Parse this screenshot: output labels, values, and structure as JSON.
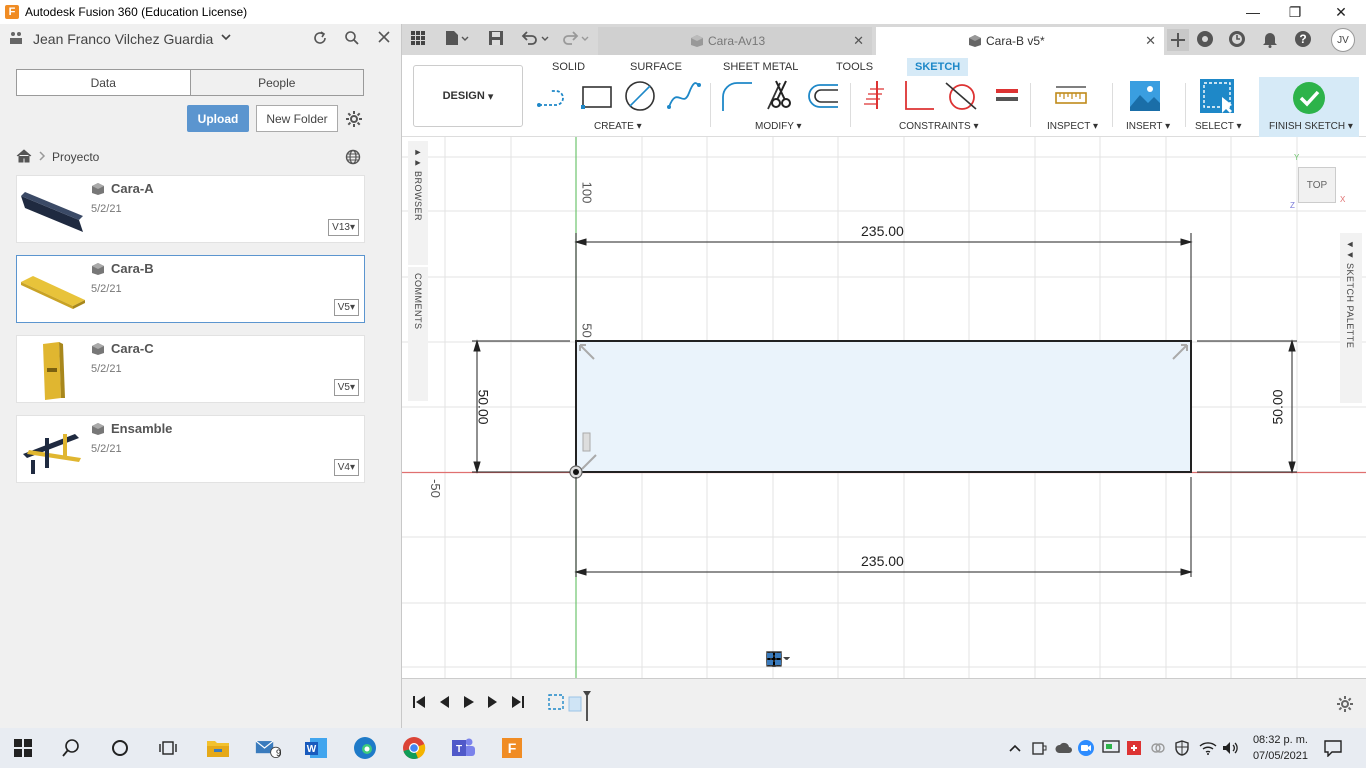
{
  "window": {
    "app_icon_letter": "F",
    "title": "Autodesk Fusion 360 (Education License)",
    "minimize": "—",
    "maximize": "❐",
    "close": "✕"
  },
  "data_panel": {
    "user_name": "Jean Franco Vilchez Guardia",
    "tabs": [
      {
        "label": "Data"
      },
      {
        "label": "People"
      }
    ],
    "upload_label": "Upload",
    "new_folder_label": "New Folder",
    "breadcrumb_project": "Proyecto",
    "files": [
      {
        "name": "Cara-A",
        "date": "5/2/21",
        "version": "V13"
      },
      {
        "name": "Cara-B",
        "date": "5/2/21",
        "version": "V5"
      },
      {
        "name": "Cara-C",
        "date": "5/2/21",
        "version": "V5"
      },
      {
        "name": "Ensamble",
        "date": "5/2/21",
        "version": "V4"
      }
    ]
  },
  "tabs": {
    "inactive_doc": "Cara-Av13",
    "active_doc": "Cara-B v5*",
    "avatar_initials": "JV"
  },
  "toolbar": {
    "workspace": "DESIGN",
    "workspace_tabs": [
      "SOLID",
      "SURFACE",
      "SHEET METAL",
      "TOOLS",
      "SKETCH"
    ],
    "active_tab": "SKETCH",
    "groups": {
      "create": "CREATE",
      "modify": "MODIFY",
      "constraints": "CONSTRAINTS",
      "inspect": "INSPECT",
      "insert": "INSERT",
      "select": "SELECT",
      "finish": "FINISH SKETCH"
    },
    "accent_color": "#1e88c8",
    "finish_color": "#2db34a"
  },
  "canvas": {
    "browser_label": "BROWSER",
    "comments_label": "COMMENTS",
    "sketch_palette_label": "SKETCH PALETTE",
    "viewcube_label": "TOP",
    "axis_labels": {
      "y100": "100",
      "y50": "50",
      "xneg50": "-50",
      "axis_x": "X",
      "axis_y": "Y",
      "axis_z": "Z"
    },
    "dimensions": {
      "top_width": "235.00",
      "bottom_width": "235.00",
      "left_height": "50.00",
      "right_height": "50.00"
    }
  },
  "timeline": {
    "settings_icon": "gear-icon"
  },
  "taskbar": {
    "clock_time": "08:32 p. m.",
    "clock_date": "07/05/2021",
    "mail_badge": "9"
  }
}
